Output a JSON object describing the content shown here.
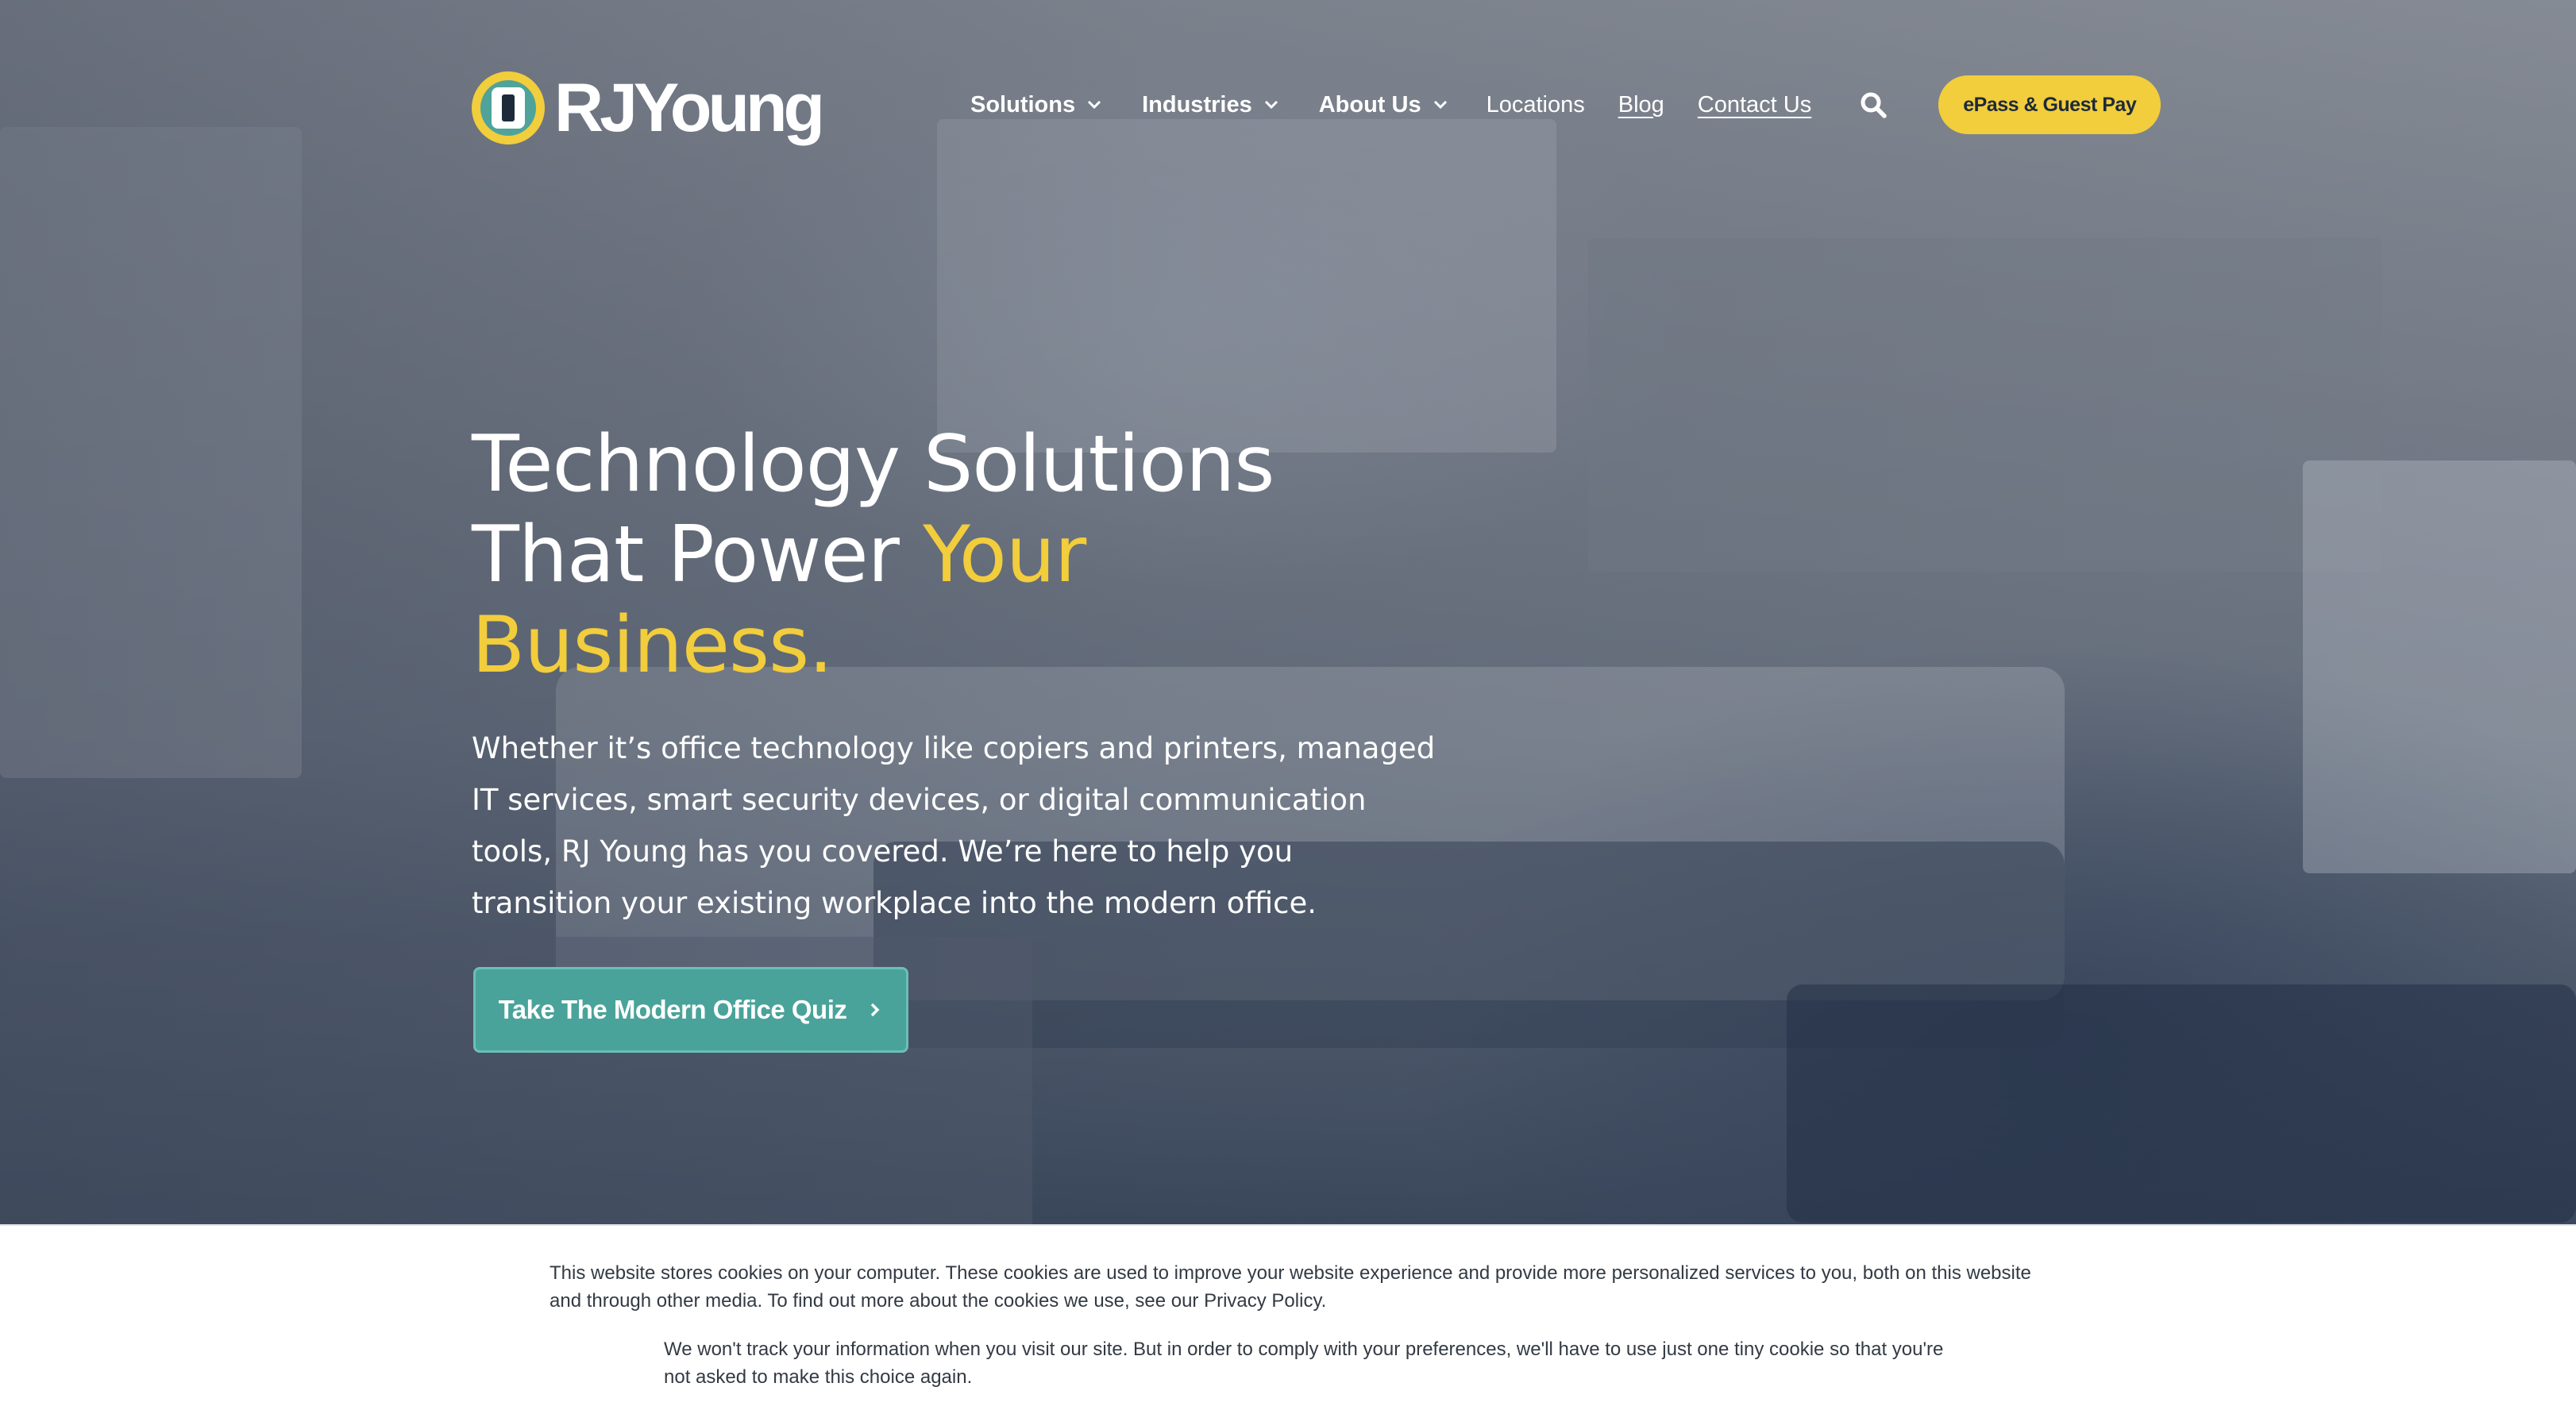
{
  "colors": {
    "brand_yellow": "#f2cd3c",
    "brand_teal": "#4aa39a",
    "navy": "#1d2a3a",
    "white": "#ffffff"
  },
  "header": {
    "logo_text": "RJYoung",
    "nav": {
      "solutions": "Solutions",
      "industries": "Industries",
      "about": "About Us",
      "locations": "Locations",
      "blog": "Blog",
      "contact": "Contact Us"
    },
    "search_icon": "search-icon",
    "epass_label": "ePass & Guest Pay"
  },
  "hero": {
    "title_line1": "Technology Solutions",
    "title_line2_plain": "That Power ",
    "title_line2_accent": "Your",
    "title_line3_accent": "Business.",
    "subtitle": "Whether it’s office technology like copiers and printers, managed IT services, smart security devices, or digital communication tools, RJ Young has you covered. We’re here to help you transition your existing workplace into the modern office.",
    "cta_label": "Take The Modern Office Quiz"
  },
  "cookie_banner": {
    "text_1": "This website stores cookies on your computer. These cookies are used to improve your website experience and provide more personalized services to you, both on this website and through other media. To find out more about the cookies we use, see our Privacy Policy.",
    "text_2": "We won't track your information when you visit our site. But in order to comply with your preferences, we'll have to use just one tiny cookie so that you're not asked to make this choice again."
  }
}
